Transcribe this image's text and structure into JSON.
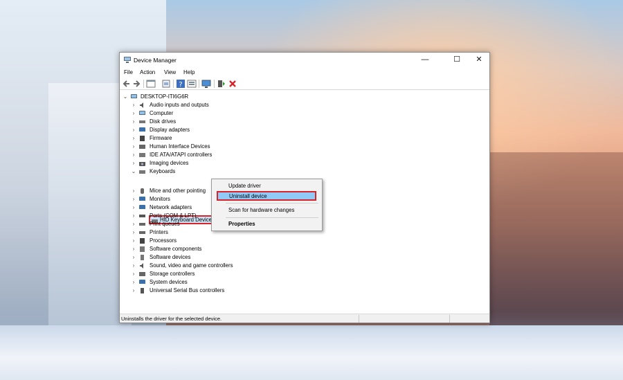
{
  "window": {
    "title": "Device Manager",
    "controls": {
      "minimize": "—",
      "maximize": "☐",
      "close": "✕"
    }
  },
  "menu": [
    "File",
    "Action",
    "View",
    "Help"
  ],
  "toolbar": {
    "icons": [
      "back-icon",
      "forward-icon",
      "properties-icon",
      "driver-icon",
      "help-icon",
      "view-icon",
      "monitor-icon",
      "add-driver-icon",
      "uninstall-icon"
    ]
  },
  "tree": {
    "root": "DESKTOP-ITI6G6R",
    "categories": [
      "Audio inputs and outputs",
      "Computer",
      "Disk drives",
      "Display adapters",
      "Firmware",
      "Human Interface Devices",
      "IDE ATA/ATAPI controllers",
      "Imaging devices",
      "Keyboards",
      "Mice and other pointing",
      "Monitors",
      "Network adapters",
      "Ports (COM & LPT)",
      "Print queues",
      "Printers",
      "Processors",
      "Software components",
      "Software devices",
      "Sound, video and game controllers",
      "Storage controllers",
      "System devices",
      "Universal Serial Bus controllers"
    ],
    "selected_child": "HID Keyboard Device"
  },
  "context_menu": {
    "items": [
      "Update driver",
      "Uninstall device",
      "Scan for hardware changes",
      "Properties"
    ],
    "highlighted": "Uninstall device"
  },
  "status_bar": {
    "text": "Uninstalls the driver for the selected device."
  },
  "colors": {
    "highlight": "#91c9f7",
    "annotation_red": "#d8232a",
    "selected_bg": "#cce4f7"
  }
}
